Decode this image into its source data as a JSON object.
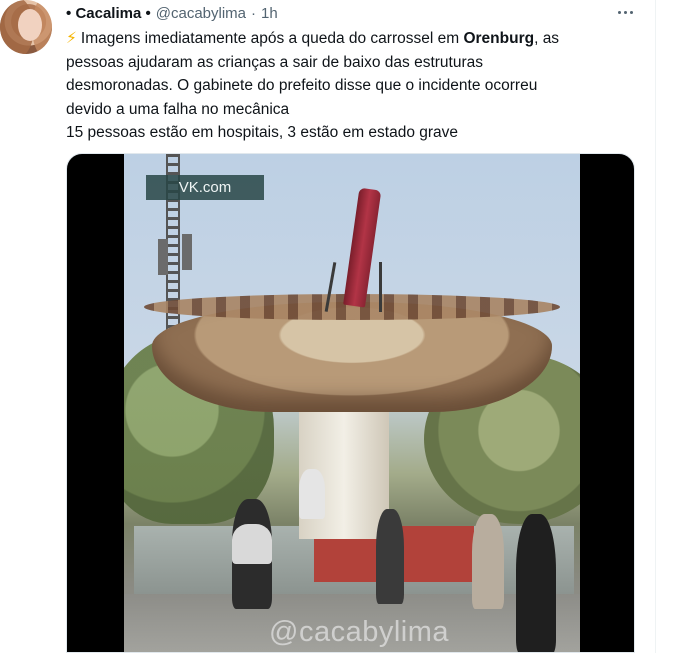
{
  "author": {
    "display_name": "Cacalima",
    "prefix_dot": "•",
    "suffix_dot": "•",
    "handle": "@cacabylima",
    "separator": "·",
    "time": "1h"
  },
  "tweet": {
    "emoji": "⚡",
    "line1_before": "Imagens imediatamente após a queda do carrossel em ",
    "line1_bold": "Orenburg",
    "line1_after": ", as",
    "line2": "pessoas ajudaram as crianças a sair de baixo das estruturas",
    "line3": "desmoronadas. O gabinete do prefeito disse que o incidente ocorreu",
    "line4": "devido a uma falha no mecânica",
    "line5": "15 pessoas estão em hospitais, 3 estão em estado grave"
  },
  "media": {
    "source_label": "VK.com",
    "watermark": "@cacabylima"
  },
  "icons": {
    "more": "more-options-icon",
    "lightning": "lightning-emoji"
  },
  "colors": {
    "text": "#0f1419",
    "secondary": "#536471",
    "lightning": "#f5b400"
  }
}
